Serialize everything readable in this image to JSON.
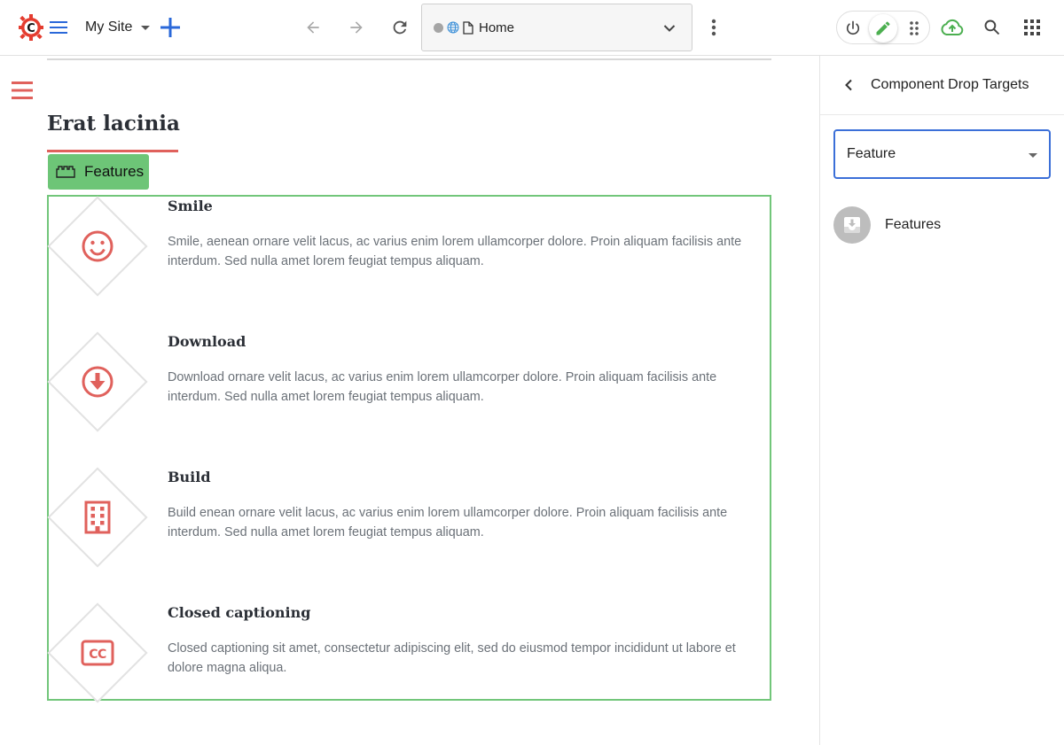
{
  "toolbar": {
    "site_name": "My Site",
    "address_url": "Home",
    "colors": {
      "brand_red": "#e43c2f",
      "accent_blue": "#2a68d9",
      "edit_green": "#4caf50"
    },
    "icons": [
      "crafter-logo-icon",
      "hamburger-icon",
      "add-icon",
      "back-arrow-icon",
      "forward-arrow-icon",
      "refresh-icon",
      "globe-icon",
      "page-icon",
      "chevron-down-icon",
      "more-vert-icon",
      "power-icon",
      "pencil-icon",
      "drag-grip-icon",
      "cloud-upload-icon",
      "search-icon",
      "apps-grid-icon"
    ]
  },
  "canvas": {
    "heading": "Erat lacinia",
    "badge_label": "Features",
    "features": [
      {
        "title": "Smile",
        "icon": "smile-icon",
        "desc": "Smile, aenean ornare velit lacus, ac varius enim lorem ullamcorper dolore. Proin aliquam facilisis ante interdum. Sed nulla amet lorem feugiat tempus aliquam."
      },
      {
        "title": "Download",
        "icon": "download-icon",
        "desc": "Download ornare velit lacus, ac varius enim lorem ullamcorper dolore. Proin aliquam facilisis ante interdum. Sed nulla amet lorem feugiat tempus aliquam."
      },
      {
        "title": "Build",
        "icon": "building-icon",
        "desc": "Build enean ornare velit lacus, ac varius enim lorem ullamcorper dolore. Proin aliquam facilisis ante interdum. Sed nulla amet lorem feugiat tempus aliquam."
      },
      {
        "title": "Closed captioning",
        "icon": "closed-caption-icon",
        "desc": "Closed captioning sit amet, consectetur adipiscing elit, sed do eiusmod tempor incididunt ut labore et dolore magna aliqua."
      }
    ]
  },
  "panel": {
    "title": "Component Drop Targets",
    "select_value": "Feature",
    "targets": [
      {
        "label": "Features",
        "icon": "move-to-inbox-icon"
      }
    ]
  }
}
